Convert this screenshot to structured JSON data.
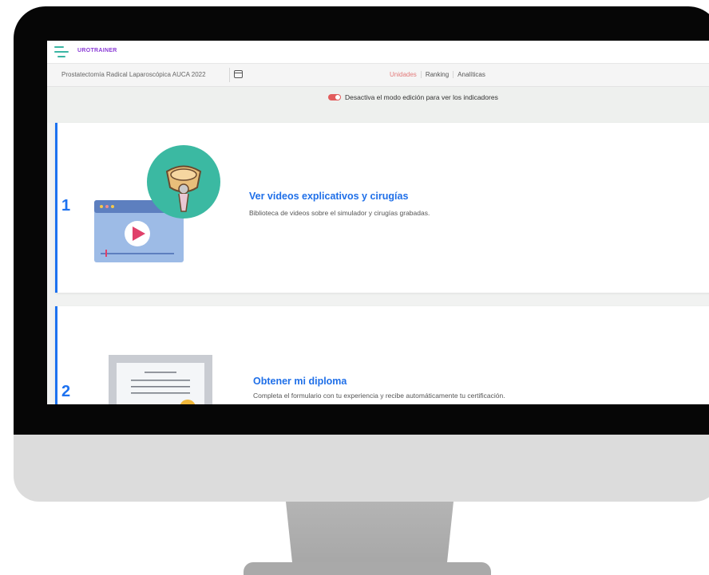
{
  "app": {
    "brand": "UROTRAINER"
  },
  "subheader": {
    "course_title": "Prostatectomía Radical Laparoscópica AUCA 2022",
    "tabs": [
      {
        "label": "Unidades",
        "active": true
      },
      {
        "label": "Ranking",
        "active": false
      },
      {
        "label": "Analíticas",
        "active": false
      }
    ]
  },
  "edit_mode": {
    "label": "Desactiva el modo edición para ver los indicadores",
    "enabled": true
  },
  "units": [
    {
      "number": "1",
      "title": "Ver videos explicativos y cirugías",
      "description": "Biblioteca de videos sobre el simulador y cirugías grabadas."
    },
    {
      "number": "2",
      "title": "Obtener mi diploma",
      "description": "Completa el formulario con tu experiencia y recibe automáticamente tu certificación."
    }
  ],
  "colors": {
    "accent": "#1d72f0",
    "brand": "#8a3ad6",
    "toggle": "#e25c5c",
    "teal": "#3bb5a3"
  }
}
